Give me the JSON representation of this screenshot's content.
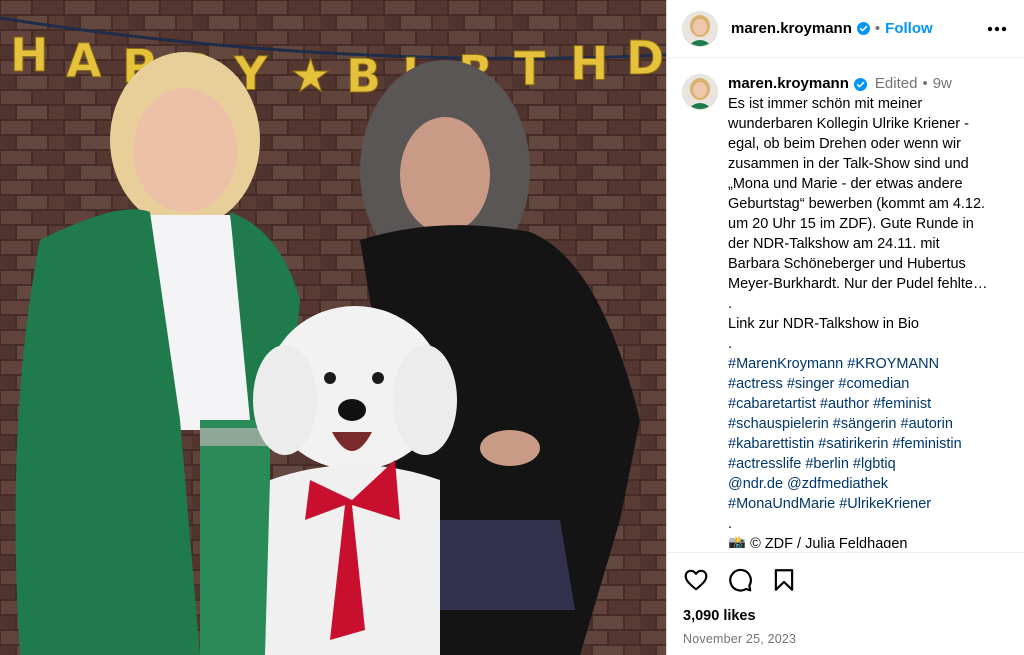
{
  "post": {
    "username": "maren.kroymann",
    "follow_label": "Follow",
    "separator": "•",
    "edited_label": "Edited",
    "age": "9w",
    "caption_lines": [
      "Es ist immer schön mit meiner",
      "wunderbaren Kollegin Ulrike Kriener -",
      "egal, ob beim Drehen oder wenn wir",
      "zusammen in der Talk-Show sind und",
      "„Mona und Marie - der etwas andere",
      "Geburtstag“ bewerben (kommt am 4.12.",
      "um 20 Uhr 15 im ZDF). Gute Runde in",
      "der NDR-Talkshow am 24.11. mit",
      "Barbara Schöneberger und Hubertus",
      "Meyer-Burkhardt. Nur der Pudel fehlte…",
      ".",
      "Link zur NDR-Talkshow in Bio",
      "."
    ],
    "hashtag_lines": [
      "#MarenKroymann #KROYMANN",
      "#actress #singer #comedian",
      "#cabaretartist #author #feminist",
      "#schauspielerin #sängerin #autorin",
      "#kabarettistin #satirikerin #feministin",
      "#actresslife #berlin #lgbtiq",
      "@ndr.de @zdfmediathek",
      "#MonaUndMarie #UlrikeKriener"
    ],
    "after_tags": ".",
    "credit": "📸 © ZDF / Julia Feldhagen",
    "likes": "3,090 likes",
    "date": "November 25, 2023"
  },
  "photo": {
    "banner_letters": [
      "H",
      "A",
      "P",
      "P",
      "Y",
      "★",
      "B",
      "I",
      "R",
      "T",
      "H",
      "D"
    ]
  },
  "icons": {
    "verified": "verified-badge-icon",
    "more": "more-options-icon",
    "like": "heart-icon",
    "comment": "comment-icon",
    "save": "bookmark-icon"
  },
  "colors": {
    "accent": "#0095f6",
    "verified": "#0095f6",
    "muted": "#737373",
    "link": "#00376b"
  }
}
